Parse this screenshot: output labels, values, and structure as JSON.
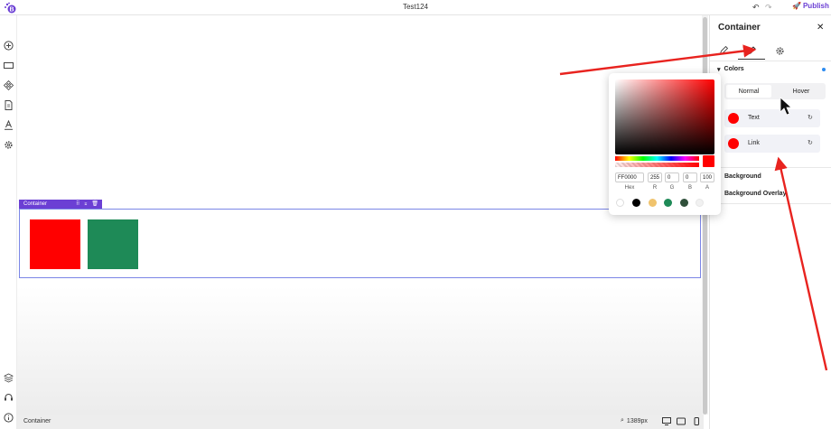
{
  "app": {
    "title": "Test124",
    "publish_label": "Publish"
  },
  "status": {
    "element_label": "Container",
    "zoom": "1389px"
  },
  "canvas": {
    "container_tag": "Container"
  },
  "panel": {
    "title": "Container",
    "colors_label": "Colors",
    "normal_label": "Normal",
    "hover_label": "Hover",
    "color_rows": [
      {
        "label": "Text",
        "color": "#ff0000"
      },
      {
        "label": "Link",
        "color": "#ff0000"
      }
    ],
    "background_label": "Background",
    "background_overlay_label": "Background Overlay"
  },
  "picker": {
    "hex": "FF0000",
    "r": "255",
    "g": "0",
    "b": "0",
    "a": "100",
    "labels": {
      "hex": "Hex",
      "r": "R",
      "g": "G",
      "b": "B",
      "a": "A"
    },
    "swatches": [
      "#ffffff",
      "#000000",
      "#f0c36d",
      "#1e8a57",
      "#2f4f3a",
      "#f1f1f1"
    ]
  },
  "colors": {
    "accent": "#6b3fd4",
    "red": "#ff0000",
    "green": "#1e8a57",
    "annotation": "#e8231f"
  }
}
